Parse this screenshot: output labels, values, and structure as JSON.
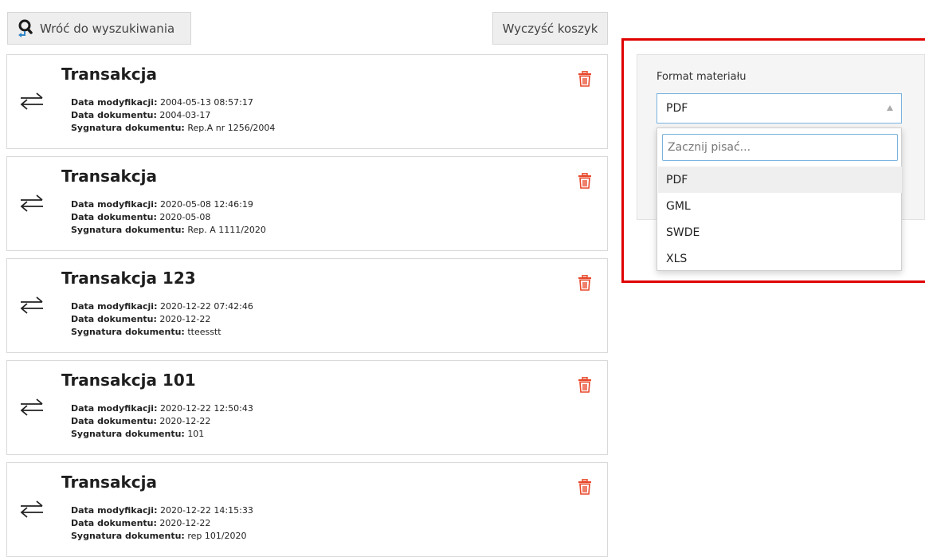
{
  "toolbar": {
    "back_label": "Wróć do wyszukiwania",
    "clear_label": "Wyczyść koszyk"
  },
  "labels": {
    "modified": "Data modyfikacji:",
    "doc_date": "Data dokumentu:",
    "signature": "Sygnatura dokumentu:"
  },
  "items": [
    {
      "title": "Transakcja",
      "modified": "2004-05-13 08:57:17",
      "doc_date": "2004-03-17",
      "signature": "Rep.A nr 1256/2004"
    },
    {
      "title": "Transakcja",
      "modified": "2020-05-08 12:46:19",
      "doc_date": "2020-05-08",
      "signature": "Rep. A 1111/2020"
    },
    {
      "title": "Transakcja 123",
      "modified": "2020-12-22 07:42:46",
      "doc_date": "2020-12-22",
      "signature": "tteesstt"
    },
    {
      "title": "Transakcja 101",
      "modified": "2020-12-22 12:50:43",
      "doc_date": "2020-12-22",
      "signature": "101"
    },
    {
      "title": "Transakcja",
      "modified": "2020-12-22 14:15:33",
      "doc_date": "2020-12-22",
      "signature": "rep 101/2020"
    }
  ],
  "format_panel": {
    "label": "Format materiału",
    "selected": "PDF",
    "search_placeholder": "Zacznij pisać...",
    "options": [
      "PDF",
      "GML",
      "SWDE",
      "XLS"
    ]
  },
  "icons": {
    "back": "search-back-icon",
    "transaction": "exchange-arrows-icon",
    "delete": "trash-icon",
    "dropdown": "caret-up-icon"
  },
  "colors": {
    "highlight": "#e00000",
    "trash": "#e8492c",
    "focus_border": "#7ab3e0"
  }
}
